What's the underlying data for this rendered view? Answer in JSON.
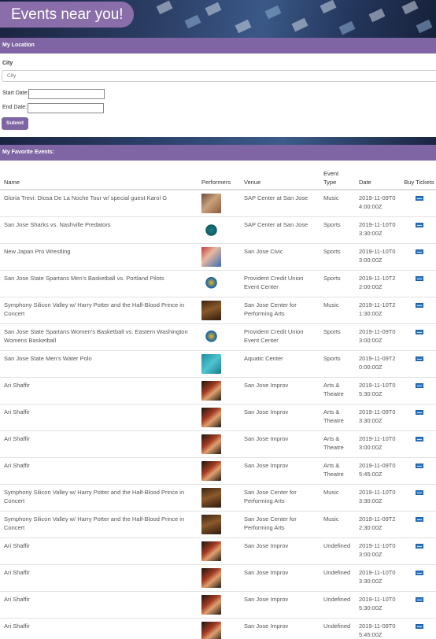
{
  "header": {
    "title": "Events near you!"
  },
  "location": {
    "section_title": "My Location",
    "city_label": "City",
    "city_placeholder": "City",
    "start_label": "Start Date:",
    "end_label": "End Date:",
    "start_value": "",
    "end_value": "",
    "submit_label": "Submit"
  },
  "favorites": {
    "section_title": "My Favorite Events:",
    "columns": {
      "name": "Name",
      "performers": "Performers",
      "venue": "Venue",
      "type": "Event Type",
      "date": "Date",
      "buy": "Buy Tickets"
    },
    "rows": [
      {
        "name": "Gloria Trevi: Diosa De La Noche Tour w/ special guest Karol G",
        "performer_icon": "performer-photo-icon",
        "venue": "SAP Center at San Jose",
        "type": "Music",
        "date": "2019-11-09T04:00:00Z"
      },
      {
        "name": "San Jose Sharks vs. Nashville Predators",
        "performer_icon": "shark-logo-icon",
        "venue": "SAP Center at San Jose",
        "type": "Sports",
        "date": "2019-11-10T03:30:00Z"
      },
      {
        "name": "New Japan Pro Wrestling",
        "performer_icon": "wrestling-photo-icon",
        "venue": "San Jose Civic",
        "type": "Sports",
        "date": "2019-11-10T03:00:00Z"
      },
      {
        "name": "San Jose State Spartans Men's Basketball vs. Portland Pilots",
        "performer_icon": "spartan-logo-icon",
        "venue": "Provident Credit Union Event Center",
        "type": "Sports",
        "date": "2019-11-10T22:00:00Z"
      },
      {
        "name": "Symphony Silicon Valley w/ Harry Potter and the Half-Blood Prince in Concert",
        "performer_icon": "orchestra-photo-icon",
        "venue": "San Jose Center for Performing Arts",
        "type": "Music",
        "date": "2019-11-10T21:30:00Z"
      },
      {
        "name": "San Jose State Spartans Women's Basketball vs. Eastern Washington Womens Basketball",
        "performer_icon": "spartan-logo-icon",
        "venue": "Provident Credit Union Event Center",
        "type": "Sports",
        "date": "2019-11-09T03:00:00Z"
      },
      {
        "name": "San Jose State Men's Water Polo",
        "performer_icon": "water-polo-photo-icon",
        "venue": "Aquatic Center",
        "type": "Sports",
        "date": "2019-11-09T20:00:00Z"
      },
      {
        "name": "Ari Shaffir",
        "performer_icon": "comedian-photo-icon",
        "venue": "San Jose Improv",
        "type": "Arts & Theatre",
        "date": "2019-11-10T05:30:00Z"
      },
      {
        "name": "Ari Shaffir",
        "performer_icon": "comedian-photo-icon",
        "venue": "San Jose Improv",
        "type": "Arts & Theatre",
        "date": "2019-11-09T03:30:00Z"
      },
      {
        "name": "Ari Shaffir",
        "performer_icon": "comedian-photo-icon",
        "venue": "San Jose Improv",
        "type": "Arts & Theatre",
        "date": "2019-11-10T03:00:00Z"
      },
      {
        "name": "Ari Shaffir",
        "performer_icon": "comedian-photo-icon",
        "venue": "San Jose Improv",
        "type": "Arts & Theatre",
        "date": "2019-11-09T05:45:00Z"
      },
      {
        "name": "Symphony Silicon Valley w/ Harry Potter and the Half-Blood Prince in Concert",
        "performer_icon": "orchestra-photo-icon",
        "venue": "San Jose Center for Performing Arts",
        "type": "Music",
        "date": "2019-11-10T03:30:00Z"
      },
      {
        "name": "Symphony Silicon Valley w/ Harry Potter and the Half-Blood Prince in Concert",
        "performer_icon": "orchestra-photo-icon",
        "venue": "San Jose Center for Performing Arts",
        "type": "Music",
        "date": "2019-11-09T22:30:00Z"
      },
      {
        "name": "Ari Shaffir",
        "performer_icon": "comedian-photo-icon",
        "venue": "San Jose Improv",
        "type": "Undefined",
        "date": "2019-11-10T03:00:00Z"
      },
      {
        "name": "Ari Shaffir",
        "performer_icon": "comedian-photo-icon",
        "venue": "San Jose Improv",
        "type": "Undefined",
        "date": "2019-11-10T03:30:00Z"
      },
      {
        "name": "Ari Shaffir",
        "performer_icon": "comedian-photo-icon",
        "venue": "San Jose Improv",
        "type": "Undefined",
        "date": "2019-11-10T05:30:00Z"
      },
      {
        "name": "Ari Shaffir",
        "performer_icon": "comedian-photo-icon",
        "venue": "San Jose Improv",
        "type": "Undefined",
        "date": "2019-11-09T05:45:00Z"
      }
    ]
  },
  "colors": {
    "accent": "#7f65a3",
    "title_pill": "#8a6eaa",
    "ticket": "#2f78c4"
  }
}
